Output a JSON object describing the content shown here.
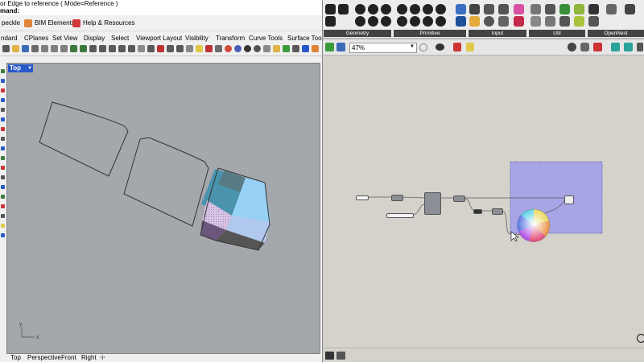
{
  "rhino": {
    "command_history": "or Edge to reference ( Mode=Reference )",
    "command_prompt": "mand:",
    "toolbar1": {
      "item0": "peckle",
      "item1": "BIM Elements",
      "item2": "Help & Resources"
    },
    "tabs": [
      "ndard",
      "CPlanes",
      "Set View",
      "Display",
      "Select",
      "Viewport Layout",
      "Visibility",
      "Transform",
      "Curve Tools",
      "Surface Tools"
    ],
    "viewport": {
      "label": "Top",
      "axis_x": "x",
      "axis_y": "y"
    },
    "bottom_tabs": [
      "Top",
      "Perspective",
      "Front",
      "Right"
    ]
  },
  "grasshopper": {
    "categories": [
      "Geometry",
      "Primitive",
      "Input",
      "Util",
      "OpenNest"
    ],
    "zoom": "47%"
  },
  "colors": {
    "viewport_bg": "#a4a7ab",
    "canvas_bg": "#d4d2cb",
    "selection_blue": "#2a58c9",
    "group_purple": "#a7a5e6"
  }
}
